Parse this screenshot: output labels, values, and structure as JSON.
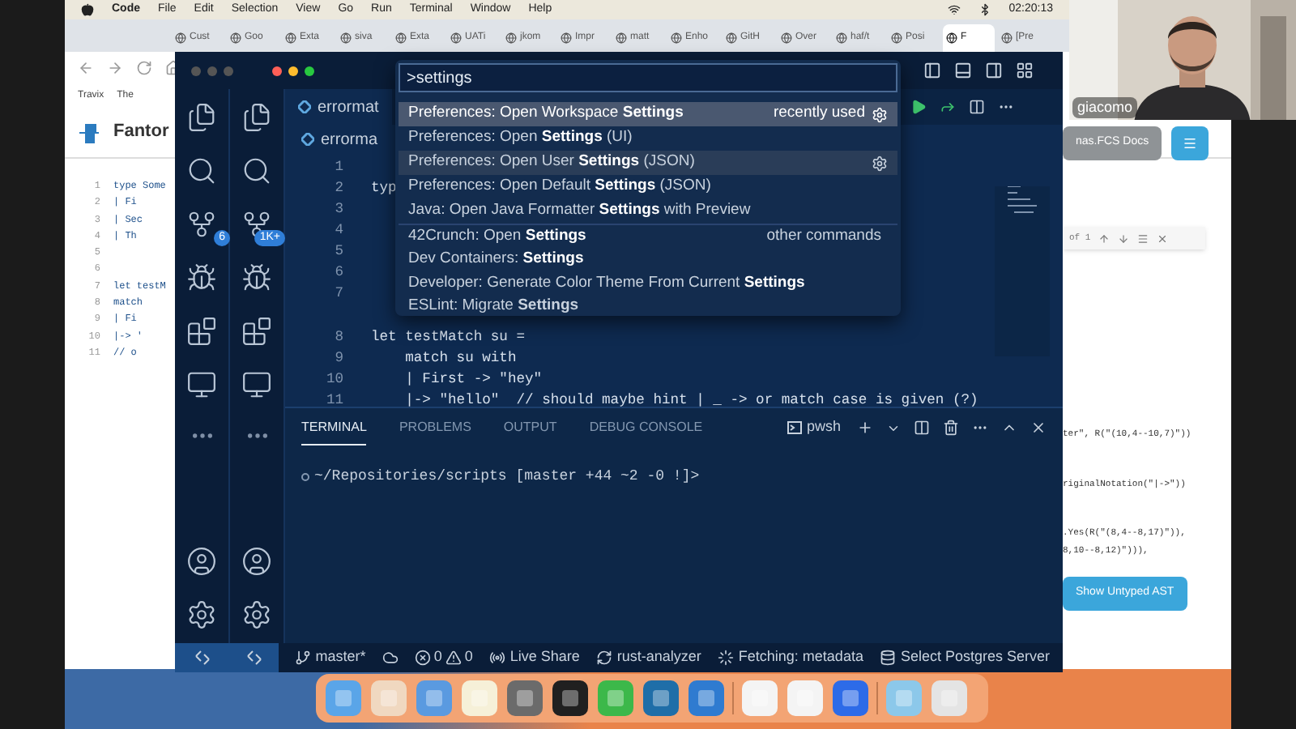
{
  "menu_bar": {
    "app": "Code",
    "items": [
      "File",
      "Edit",
      "Selection",
      "View",
      "Go",
      "Run",
      "Terminal",
      "Window",
      "Help"
    ],
    "clock": "02:20:13"
  },
  "browser": {
    "tabs": [
      {
        "label": "Cust",
        "selected": false
      },
      {
        "label": "Goo",
        "selected": false
      },
      {
        "label": "Exta",
        "selected": false
      },
      {
        "label": "siva",
        "selected": false
      },
      {
        "label": "Exta",
        "selected": false
      },
      {
        "label": "UATi",
        "selected": false
      },
      {
        "label": "jkom",
        "selected": false
      },
      {
        "label": "Impr",
        "selected": false
      },
      {
        "label": "matt",
        "selected": false
      },
      {
        "label": "Enho",
        "selected": false
      },
      {
        "label": "GitH",
        "selected": false
      },
      {
        "label": "Over",
        "selected": false
      },
      {
        "label": "haf/t",
        "selected": false
      },
      {
        "label": "Posi",
        "selected": false
      },
      {
        "label": "F",
        "selected": true
      },
      {
        "label": "[Pre",
        "selected": false
      }
    ],
    "bookmarks": [
      "Travix",
      "The"
    ],
    "site_title": "Fantor",
    "code_lines": [
      {
        "number": "1",
        "text": "type Some"
      },
      {
        "number": "2",
        "text": "| Fi"
      },
      {
        "number": "3",
        "text": "| Sec"
      },
      {
        "number": "4",
        "text": "| Th"
      },
      {
        "number": "5"
      },
      {
        "number": "6"
      },
      {
        "number": "7",
        "text": "let testM"
      },
      {
        "number": "8",
        "text": "match"
      },
      {
        "number": "9",
        "text": "| Fi"
      },
      {
        "number": "10",
        "text": "|-> '"
      },
      {
        "number": "11",
        "text": "// o"
      }
    ],
    "docs_button": "nas.FCS Docs",
    "find_count": "of 1",
    "right_code_groups": [
      [
        "ter\", R(\"(10,4--10,7)\"))"
      ],
      [
        "riginalNotation(\"|->\"))"
      ],
      [
        ".Yes(R(\"(8,4--8,17)\")),",
        "8,10--8,12)\"))),"
      ]
    ],
    "ast_button": "Show Untyped AST"
  },
  "vscode": {
    "activity_bars": [
      {
        "badge": "6"
      },
      {
        "badge": "1K+"
      }
    ],
    "editor_tab": "errormat",
    "breadcrumb": "errorma",
    "code_lines": [
      {
        "number": "1"
      },
      {
        "number": "2",
        "text": "typ"
      },
      {
        "number": "3"
      },
      {
        "number": "4"
      },
      {
        "number": "5"
      },
      {
        "number": "6"
      },
      {
        "number": "7"
      },
      {
        "number": "8",
        "text": "let testMatch su ="
      },
      {
        "number": "9",
        "text": "    match su with"
      },
      {
        "number": "10",
        "text": "    | First -> \"hey\""
      },
      {
        "number": "11",
        "text": "    |-> \"hello\"  // should maybe hint | _ -> or match case is given (?)"
      }
    ],
    "palette": {
      "query": ">settings",
      "items": [
        {
          "label": "Preferences: Open Workspace **Settings**",
          "detail": "recently used",
          "selected": true,
          "hovered": false
        },
        {
          "label": "Preferences: Open **Settings** (UI)",
          "selected": false,
          "hovered": false
        },
        {
          "label": "Preferences: Open User **Settings** (JSON)",
          "selected": false,
          "hovered": true
        },
        {
          "label": "Preferences: Open Default **Settings** (JSON)",
          "selected": false,
          "hovered": false
        },
        {
          "label": "Java: Open Java Formatter **Settings** with Preview",
          "selected": false,
          "hovered": false
        },
        {
          "label": "42Crunch: Open **Settings**",
          "detail": "other commands",
          "selected": false,
          "hovered": false
        },
        {
          "label": "Dev Containers: **Settings**",
          "selected": false,
          "hovered": false
        },
        {
          "label": "Developer: Generate Color Theme From Current **Settings**",
          "selected": false,
          "hovered": false
        },
        {
          "label": "ESLint: Migrate **Settings**",
          "selected": false,
          "hovered": false
        }
      ]
    },
    "panel_tabs": [
      {
        "label": "TERMINAL",
        "selected": true
      },
      {
        "label": "PROBLEMS",
        "selected": false
      },
      {
        "label": "OUTPUT",
        "selected": false
      },
      {
        "label": "DEBUG CONSOLE",
        "selected": false
      }
    ],
    "shell": "pwsh",
    "terminal_line": "~/Repositories/scripts [master +44 ~2 -0 !]>",
    "status_bar": [
      {
        "kind": "branch",
        "text": "master*"
      },
      {
        "kind": "cloud"
      },
      {
        "kind": "problems",
        "errors": "0",
        "warnings": "0"
      },
      {
        "kind": "liveshare",
        "text": "Live Share"
      },
      {
        "kind": "sync",
        "text": "rust-analyzer"
      },
      {
        "kind": "loading",
        "text": "Fetching: metadata"
      },
      {
        "kind": "server",
        "text": "Select Postgres Server"
      }
    ]
  },
  "webcam": {
    "name": "giacomo"
  }
}
